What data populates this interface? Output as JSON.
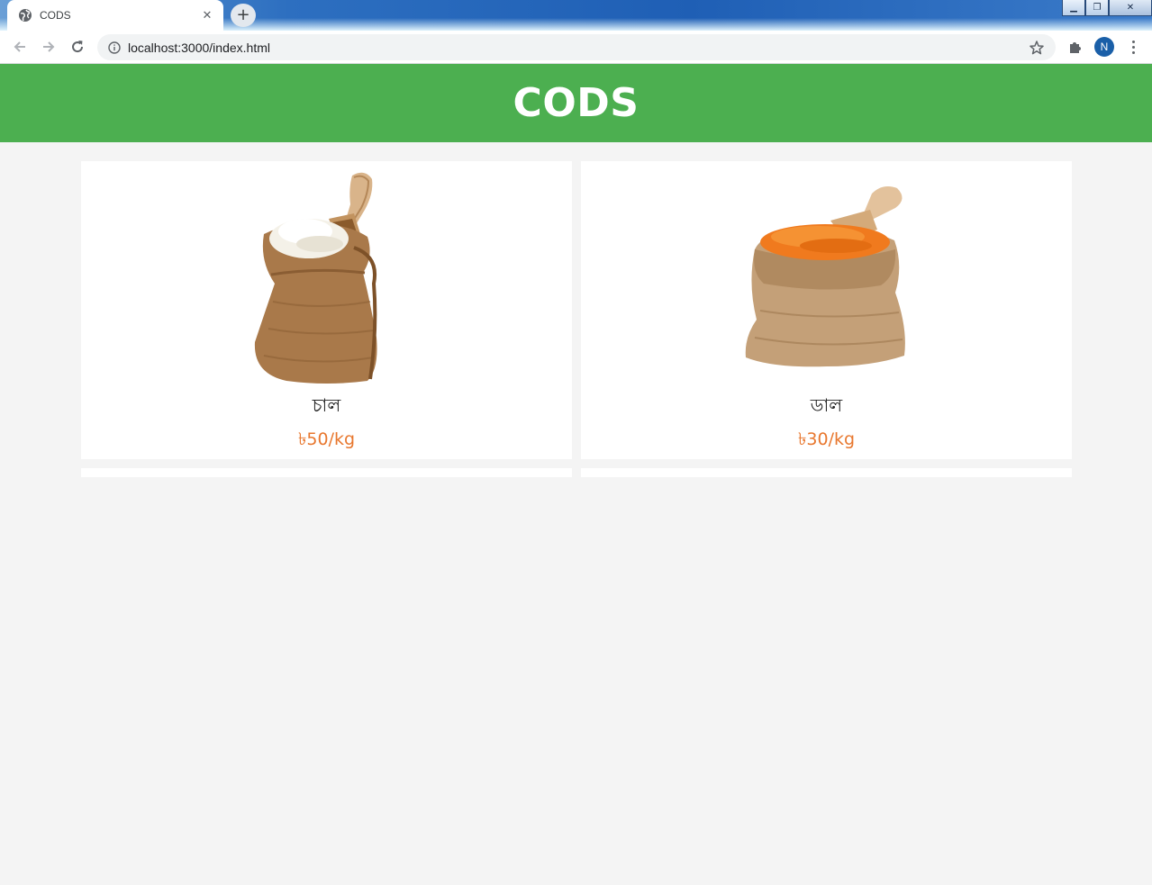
{
  "browser": {
    "tab_title": "CODS",
    "tab_close": "✕",
    "new_tab": "+",
    "url": "localhost:3000/index.html",
    "profile_initial": "N",
    "window_controls": {
      "minimize": "▁",
      "restore": "❐",
      "close": "✕"
    }
  },
  "header": {
    "title": "CODS",
    "background_color": "#4caf50"
  },
  "products": [
    {
      "name": "চাল",
      "price": "৳50/kg",
      "image": "rice-sack"
    },
    {
      "name": "ডাল",
      "price": "৳30/kg",
      "image": "lentil-sack"
    }
  ],
  "colors": {
    "price": "#e8772e",
    "page_background": "#f4f4f4",
    "card_background": "#ffffff"
  }
}
